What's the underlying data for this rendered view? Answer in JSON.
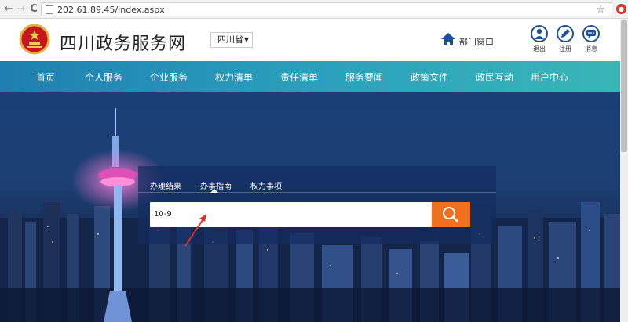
{
  "browser": {
    "url": "202.61.89.45/index.aspx",
    "back": "←",
    "forward": "→",
    "reload": "C"
  },
  "header": {
    "title": "四川政务服务网",
    "region_select": "四川省",
    "dept_link": "部门窗口",
    "actions": [
      {
        "label": "退出",
        "icon": "user-icon"
      },
      {
        "label": "注册",
        "icon": "pen-icon"
      },
      {
        "label": "消息",
        "icon": "message-icon"
      }
    ]
  },
  "nav": {
    "items": [
      "首页",
      "个人服务",
      "企业服务",
      "权力清单",
      "责任清单",
      "服务要闻",
      "政策文件",
      "政民互动",
      "用户中心"
    ]
  },
  "search": {
    "tabs": [
      "办理结果",
      "办事指南",
      "权力事项"
    ],
    "active_tab": "办事指南",
    "query": "10-9"
  },
  "colors": {
    "nav_start": "#1f7fb0",
    "nav_end": "#3ab6b7",
    "search_button": "#f07020",
    "header_icon": "#1d4f9a"
  }
}
